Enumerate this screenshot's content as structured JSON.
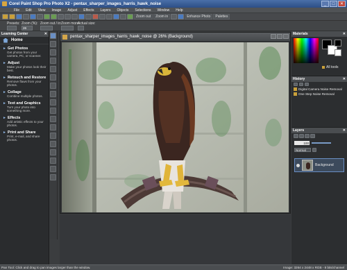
{
  "window": {
    "title": "Corel Paint Shop Pro Photo X2 - pentax_sharper_images_harris_hawk_noise",
    "buttons": [
      "_",
      "□",
      "✕"
    ]
  },
  "menu": [
    "File",
    "Edit",
    "View",
    "Image",
    "Adjust",
    "Effects",
    "Layers",
    "Objects",
    "Selections",
    "Window",
    "Help"
  ],
  "toolbar": {
    "zoom_out": "Zoom out",
    "zoom_in": "Zoom in",
    "enhance_photo": "Enhance Photo",
    "palettes": "Palettes"
  },
  "tool_options": {
    "presets": "Presets:",
    "zoom": "Zoom (%):",
    "zoom_value": "26",
    "zoom_out_in": "Zoom out / in:",
    "zoom_more": "Zoom more:",
    "actual_size": "Actual size:"
  },
  "learning_center": {
    "title": "Learning Center",
    "home": "Home",
    "items": [
      {
        "title": "Get Photos",
        "desc": "Get photos from your camera, PC, or scanner."
      },
      {
        "title": "Adjust",
        "desc": "Make your photos look their best."
      },
      {
        "title": "Retouch and Restore",
        "desc": "Remove flaws from your photos."
      },
      {
        "title": "Collage",
        "desc": "Combine multiple photos."
      },
      {
        "title": "Text and Graphics",
        "desc": "Turn your photo into something more."
      },
      {
        "title": "Effects",
        "desc": "Add artistic effects to your photos."
      },
      {
        "title": "Print and Share",
        "desc": "Print, e-mail, and share photos."
      }
    ]
  },
  "document": {
    "title": "pentax_sharper_images_harris_hawk_noise @ 26% (Background)"
  },
  "palettes": {
    "materials": "Materials",
    "all_tools": "All tools",
    "history": "History",
    "history_items": [
      "Digital Camera Noise Removal",
      "One Step Noise Removal"
    ],
    "layers": "Layers",
    "opacity": "100",
    "blend_mode": "Normal",
    "layer_name": "Background"
  },
  "status": {
    "left": "Pan Tool: Click and drag to pan images larger than the window.",
    "right": "Image: 3264 x 2448 x RGB - 8 bits/channel"
  },
  "colors": {
    "accent": "#6a8fc4",
    "title_bar": "#2c4e86"
  }
}
